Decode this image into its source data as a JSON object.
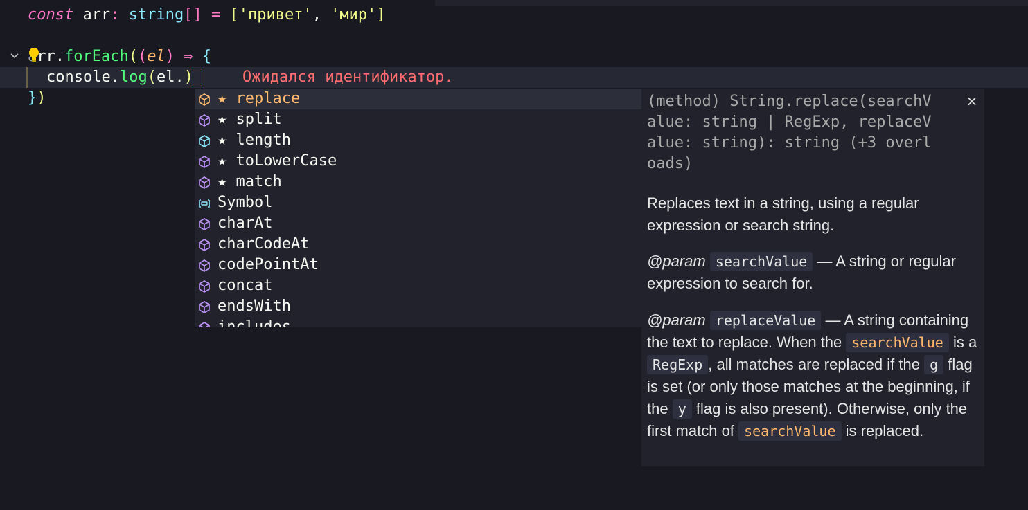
{
  "code": {
    "line1": {
      "kw": "const",
      "name": "arr",
      "colon": ":",
      "type": "string",
      "brackets": "[]",
      "eq": "=",
      "open": "[",
      "s1": "'привет'",
      "comma": ",",
      "s2": "'мир'",
      "close": "]"
    },
    "line3": {
      "a": "a",
      "rest": "rr",
      "dot": ".",
      "method": "forEach",
      "p1": "(",
      "p2": "(",
      "param": "el",
      "p3": ")",
      "arrow": "⇒",
      "brace": "{"
    },
    "line4": {
      "obj": "console",
      "dot": ".",
      "method": "log",
      "p1": "(",
      "expr": "el.",
      "p2": ")"
    },
    "line5": {
      "brace": "}",
      "paren": ")"
    }
  },
  "inline_error": "Ожидался идентификатор.",
  "suggestions": [
    {
      "label": "★ replace",
      "icon": "method-icon",
      "selected": true
    },
    {
      "label": "★ split",
      "icon": "method-icon"
    },
    {
      "label": "★ length",
      "icon": "property-icon"
    },
    {
      "label": "★ toLowerCase",
      "icon": "method-icon"
    },
    {
      "label": "★ match",
      "icon": "method-icon"
    },
    {
      "label": "Symbol",
      "icon": "variable-icon"
    },
    {
      "label": "charAt",
      "icon": "method-icon"
    },
    {
      "label": "charCodeAt",
      "icon": "method-icon"
    },
    {
      "label": "codePointAt",
      "icon": "method-icon"
    },
    {
      "label": "concat",
      "icon": "method-icon"
    },
    {
      "label": "endsWith",
      "icon": "method-icon"
    },
    {
      "label": "includes",
      "icon": "method-icon"
    }
  ],
  "details": {
    "signature": "(method) String.replace(searchV\nalue: string | RegExp, replaceV\nalue: string): string (+3 overl\noads)",
    "close_symbol": "×",
    "description": "Replaces text in a string, using a regular expression or search string.",
    "param1": {
      "tag": "@param",
      "name": "searchValue",
      "text": " — A string or regular expression to search for."
    },
    "param2": {
      "tag": "@param",
      "name": "replaceValue",
      "t1": " — A string containing the text to replace. When the ",
      "c1": "searchValue",
      "t2": " is a ",
      "c2": "RegExp",
      "t3": ", all matches are replaced if the ",
      "c3": "g",
      "t4": " flag is set (or only those matches at the beginning, if the ",
      "c4": "y",
      "t5": " flag is also present). Otherwise, only the first match of ",
      "c5": "searchValue",
      "t6": " is replaced."
    }
  },
  "colors": {
    "background": "#191a21",
    "widget_bg": "#21222c",
    "keyword": "#ff79c6",
    "type": "#8be9fd",
    "string": "#f1fa8c",
    "function": "#50fa7b",
    "parameter": "#ffb86c",
    "error": "#ff6e6e",
    "method_icon": "#bd93f9",
    "property_icon": "#8be9fd"
  }
}
